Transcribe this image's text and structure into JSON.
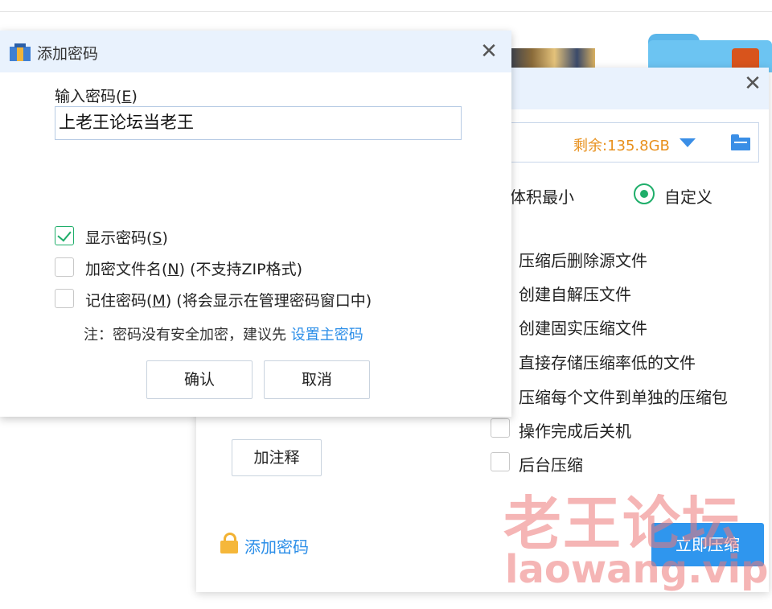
{
  "main_window": {
    "free_space": "剩余:135.8GB",
    "mode_left_partial": "体积最小",
    "mode_custom": "自定义",
    "options": [
      "压缩后删除源文件",
      "创建自解压文件",
      "创建固实压缩文件",
      "直接存储压缩率低的文件",
      "压缩每个文件到单独的压缩包",
      "操作完成后关机",
      "后台压缩"
    ],
    "add_comment": "加注释",
    "add_password_link": "添加密码",
    "compress_now": "立即压缩"
  },
  "password_dialog": {
    "title": "添加密码",
    "input_label_prefix": "输入密码(",
    "input_label_key": "E",
    "input_label_suffix": ")",
    "password_value": "上老王论坛当老王",
    "show_password": {
      "prefix": "显示密码(",
      "key": "S",
      "suffix": ")",
      "checked": true
    },
    "encrypt_filenames": {
      "prefix": "加密文件名(",
      "key": "N",
      "suffix": ") (不支持ZIP格式)",
      "checked": false
    },
    "remember_password": {
      "prefix": "记住密码(",
      "key": "M",
      "suffix": ") (将会显示在管理密码窗口中)",
      "checked": false
    },
    "note_text": "注：密码没有安全加密，建议先 ",
    "note_link": "设置主密码",
    "confirm": "确认",
    "cancel": "取消"
  },
  "watermark": {
    "line1": "老王论坛",
    "line2": "laowang.vip"
  },
  "colors": {
    "accent_blue": "#2f96ee",
    "link_blue": "#2b8ee8",
    "check_green": "#1fae6a",
    "free_space_orange": "#e8901c",
    "header_bg": "#e9f2fd"
  }
}
